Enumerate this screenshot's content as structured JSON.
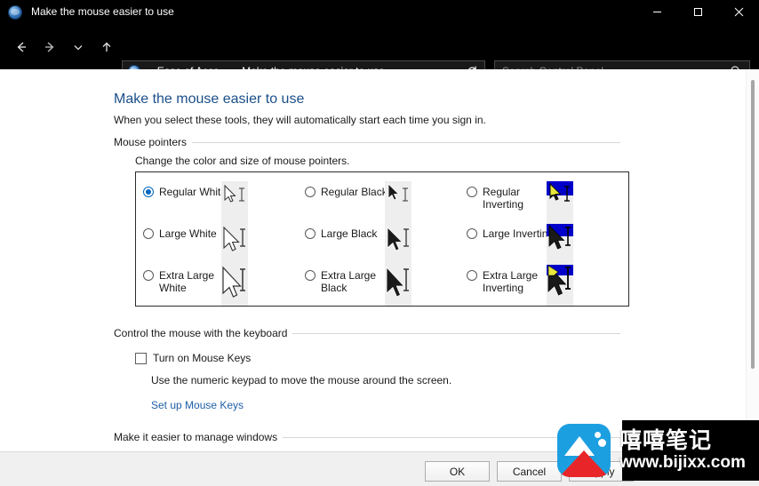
{
  "window": {
    "title": "Make the mouse easier to use",
    "icon": "ease-of-access-icon",
    "controls": {
      "minimize": "Minimize",
      "maximize": "Maximize",
      "close": "Close"
    }
  },
  "nav": {
    "back": "Back",
    "forward": "Forward",
    "recent": "Recent locations",
    "up": "Up one level",
    "address": {
      "prefix": "«",
      "crumb1": "Ease of Acce...",
      "separator": "›",
      "crumb2": "Make the mouse easier to use",
      "dropdown": "Previous locations",
      "refresh": "Refresh"
    },
    "search": {
      "placeholder": "Search Control Panel",
      "icon": "search-icon"
    }
  },
  "page": {
    "title": "Make the mouse easier to use",
    "subtitle": "When you select these tools, they will automatically start each time you sign in."
  },
  "sections": {
    "mouse_pointers": {
      "heading": "Mouse pointers",
      "description": "Change the color and size of mouse pointers.",
      "options": [
        {
          "id": "regular-white",
          "label": "Regular White",
          "checked": true,
          "style": "white",
          "size": "regular"
        },
        {
          "id": "large-white",
          "label": "Large White",
          "checked": false,
          "style": "white",
          "size": "large"
        },
        {
          "id": "extra-large-white",
          "label": "Extra Large White",
          "checked": false,
          "style": "white",
          "size": "xlarge"
        },
        {
          "id": "regular-black",
          "label": "Regular Black",
          "checked": false,
          "style": "black",
          "size": "regular"
        },
        {
          "id": "large-black",
          "label": "Large Black",
          "checked": false,
          "style": "black",
          "size": "large"
        },
        {
          "id": "extra-large-black",
          "label": "Extra Large Black",
          "checked": false,
          "style": "black",
          "size": "xlarge"
        },
        {
          "id": "regular-inverting",
          "label": "Regular Inverting",
          "checked": false,
          "style": "inverting",
          "size": "regular"
        },
        {
          "id": "large-inverting",
          "label": "Large Inverting",
          "checked": false,
          "style": "inverting",
          "size": "large"
        },
        {
          "id": "extra-large-inverting",
          "label": "Extra Large Inverting",
          "checked": false,
          "style": "inverting",
          "size": "xlarge"
        }
      ]
    },
    "keyboard_control": {
      "heading": "Control the mouse with the keyboard",
      "checkbox_label": "Turn on Mouse Keys",
      "checkbox_checked": false,
      "description": "Use the numeric keypad to move the mouse around the screen.",
      "link": "Set up Mouse Keys"
    },
    "manage_windows": {
      "heading": "Make it easier to manage windows"
    }
  },
  "footer": {
    "ok": "OK",
    "cancel": "Cancel",
    "apply": "Apply"
  },
  "watermark": {
    "cn_text": "嘻嘻笔记",
    "url": "www.bijixx.com",
    "logo": "mountain-logo"
  },
  "colors": {
    "accent": "#0067c0",
    "title_link": "#1b4f8a",
    "chrome": "#000000",
    "content_bg": "#ffffff",
    "footer_bg": "#f0f0f0",
    "inverting_blue": "#0000c8",
    "watermark_blue": "#1c9fe0",
    "watermark_red": "#e8262a"
  }
}
